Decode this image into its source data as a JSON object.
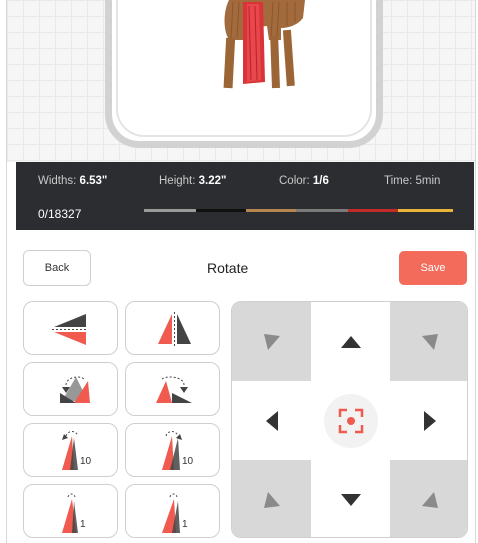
{
  "info": {
    "width_label": "Widths:",
    "width_value": "6.53\"",
    "height_label": "Height:",
    "height_value": "3.22\"",
    "color_label": "Color:",
    "color_value": "1/6",
    "time_label": "Time:",
    "time_value": "5min",
    "stitch_count": "0/18327",
    "thread_colors": [
      "#9a9a9a",
      "#111111",
      "#b5854e",
      "#7a7a7a",
      "#c22a2a",
      "#e8b53a"
    ]
  },
  "header": {
    "back_label": "Back",
    "title": "Rotate",
    "save_label": "Save"
  },
  "tools": {
    "rotate_cw_10_label": "10",
    "rotate_ccw_10_label": "10",
    "rotate_cw_1_label": "1",
    "rotate_ccw_1_label": "1"
  },
  "colors": {
    "accent": "#f26b5b",
    "shape_dark": "#444444",
    "shape_red": "#f05a4f"
  }
}
